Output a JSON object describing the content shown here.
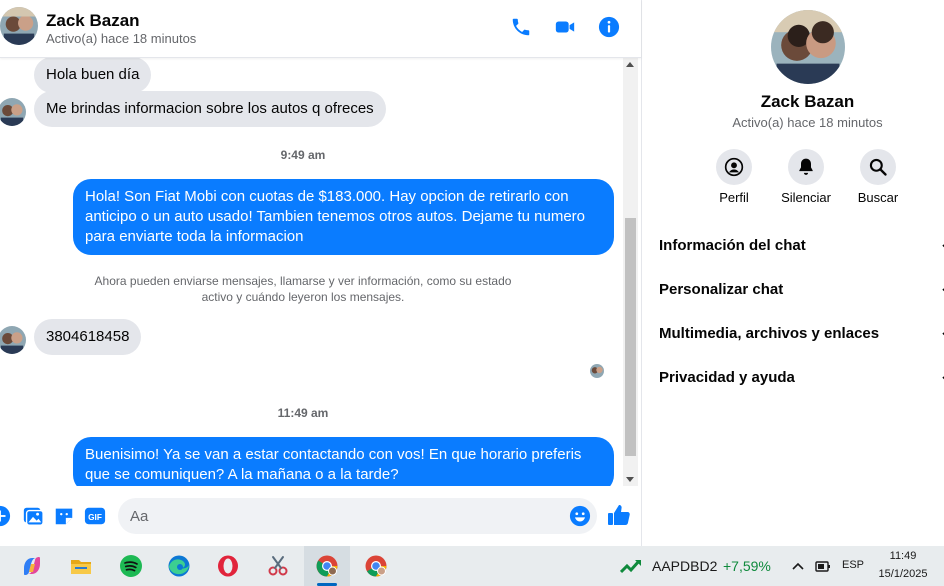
{
  "colors": {
    "accent": "#0a7cff",
    "bubble_in": "#e4e6eb",
    "muted": "#65676b"
  },
  "chat": {
    "contact_name": "Zack Bazan",
    "contact_status": "Activo(a) hace 18 minutos",
    "header_icons": [
      "phone-icon",
      "video-camera-icon",
      "info-icon"
    ],
    "messages": {
      "m1": "Hola buen día",
      "m2": "Me brindas informacion sobre los autos q ofreces",
      "time1": "9:49 am",
      "m3": "Hola! Son Fiat Mobi con cuotas de $183.000. Hay opcion de retirarlo con anticipo o un auto usado! Tambien tenemos otros autos. Dejame tu numero para enviarte toda la informacion",
      "system": "Ahora pueden enviarse mensajes, llamarse y ver información, como su estado activo y cuándo leyeron los mensajes.",
      "m4": "3804618458",
      "time2": "11:49 am",
      "m5": "Buenisimo! Ya se van a estar contactando con vos! En que horario preferis que se comuniquen? A la mañana o a la tarde?"
    },
    "composer": {
      "placeholder": "Aa",
      "icons": [
        "plus-icon",
        "image-icon",
        "sticker-icon",
        "gif-icon",
        "emoji-icon",
        "thumbs-up-icon"
      ],
      "gif_label": "GIF"
    }
  },
  "panel": {
    "name": "Zack Bazan",
    "status": "Activo(a) hace 18 minutos",
    "actions": [
      {
        "label": "Perfil",
        "icon": "profile-icon"
      },
      {
        "label": "Silenciar",
        "icon": "bell-icon"
      },
      {
        "label": "Buscar",
        "icon": "search-icon"
      }
    ],
    "sections": [
      "Información del chat",
      "Personalizar chat",
      "Multimedia, archivos y enlaces",
      "Privacidad y ayuda"
    ]
  },
  "taskbar": {
    "apps": [
      "copilot-icon",
      "file-explorer-icon",
      "spotify-icon",
      "edge-icon",
      "opera-icon",
      "snipping-tool-icon",
      "chrome-icon",
      "chrome-icon"
    ],
    "stock_name": "AAPDBD2",
    "stock_change": "+7,59%",
    "language": "ESP",
    "time": "11:49",
    "date": "15/1/2025"
  }
}
